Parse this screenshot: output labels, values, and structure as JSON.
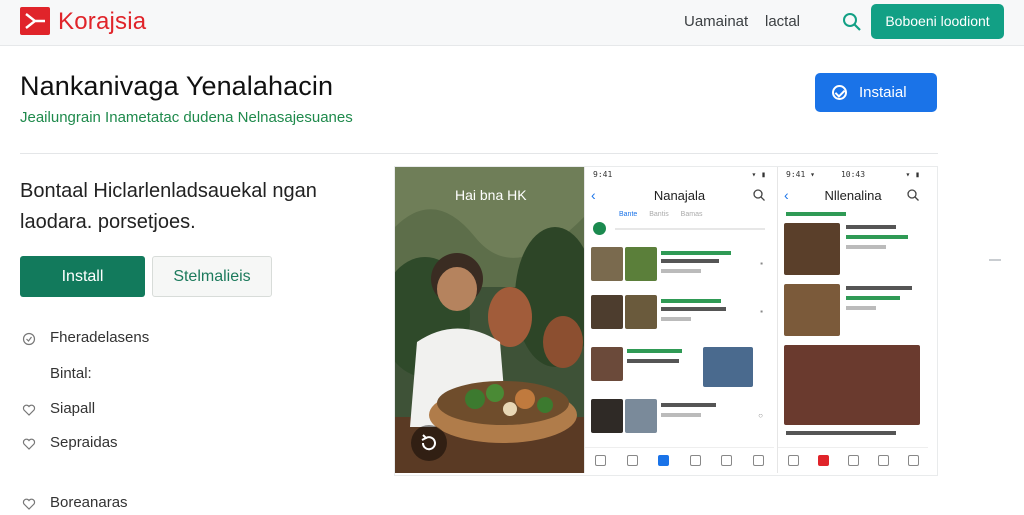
{
  "header": {
    "brand": "Korajsia",
    "nav": [
      "Uamainat",
      "lactal"
    ],
    "search_icon": "search-icon",
    "cta_label": "Boboeni loodiont",
    "brand_color": "#e0242a",
    "accent_color": "#12a085"
  },
  "app": {
    "title": "Nankanivaga Yenalahacin",
    "subtitle": "Jeailungrain Inametatac dudena Nelnasajesuanes",
    "install_label": "Instaial",
    "install_color": "#1a73e8"
  },
  "main": {
    "description": "Bontaal Hiclarlenladsauekal ngan laodara. porsetjoes.",
    "install_label": "Install",
    "secondary_label": "Stelmalieis",
    "features": [
      {
        "label": "Fheradelasens",
        "icon": "check-circle-icon"
      },
      {
        "label": "Bintal:",
        "icon": ""
      },
      {
        "label": "Siapall",
        "icon": "heart-icon"
      },
      {
        "label": "Sepraidas",
        "icon": "heart-icon"
      },
      {
        "label": "Boreanaras",
        "icon": "heart-icon"
      }
    ]
  },
  "screens": {
    "photo_caption": "Hai bna HK",
    "phone1": {
      "title": "Nanajala",
      "tabs": [
        "Bante",
        "Bantis",
        "Bamas"
      ],
      "status_left": "9:41",
      "status_right": "▾ ▮"
    },
    "phone2": {
      "title": "Nllenalina",
      "status_left": "9:41 ▾",
      "status_mid": "10:43",
      "status_right": "▾ ▮"
    }
  }
}
